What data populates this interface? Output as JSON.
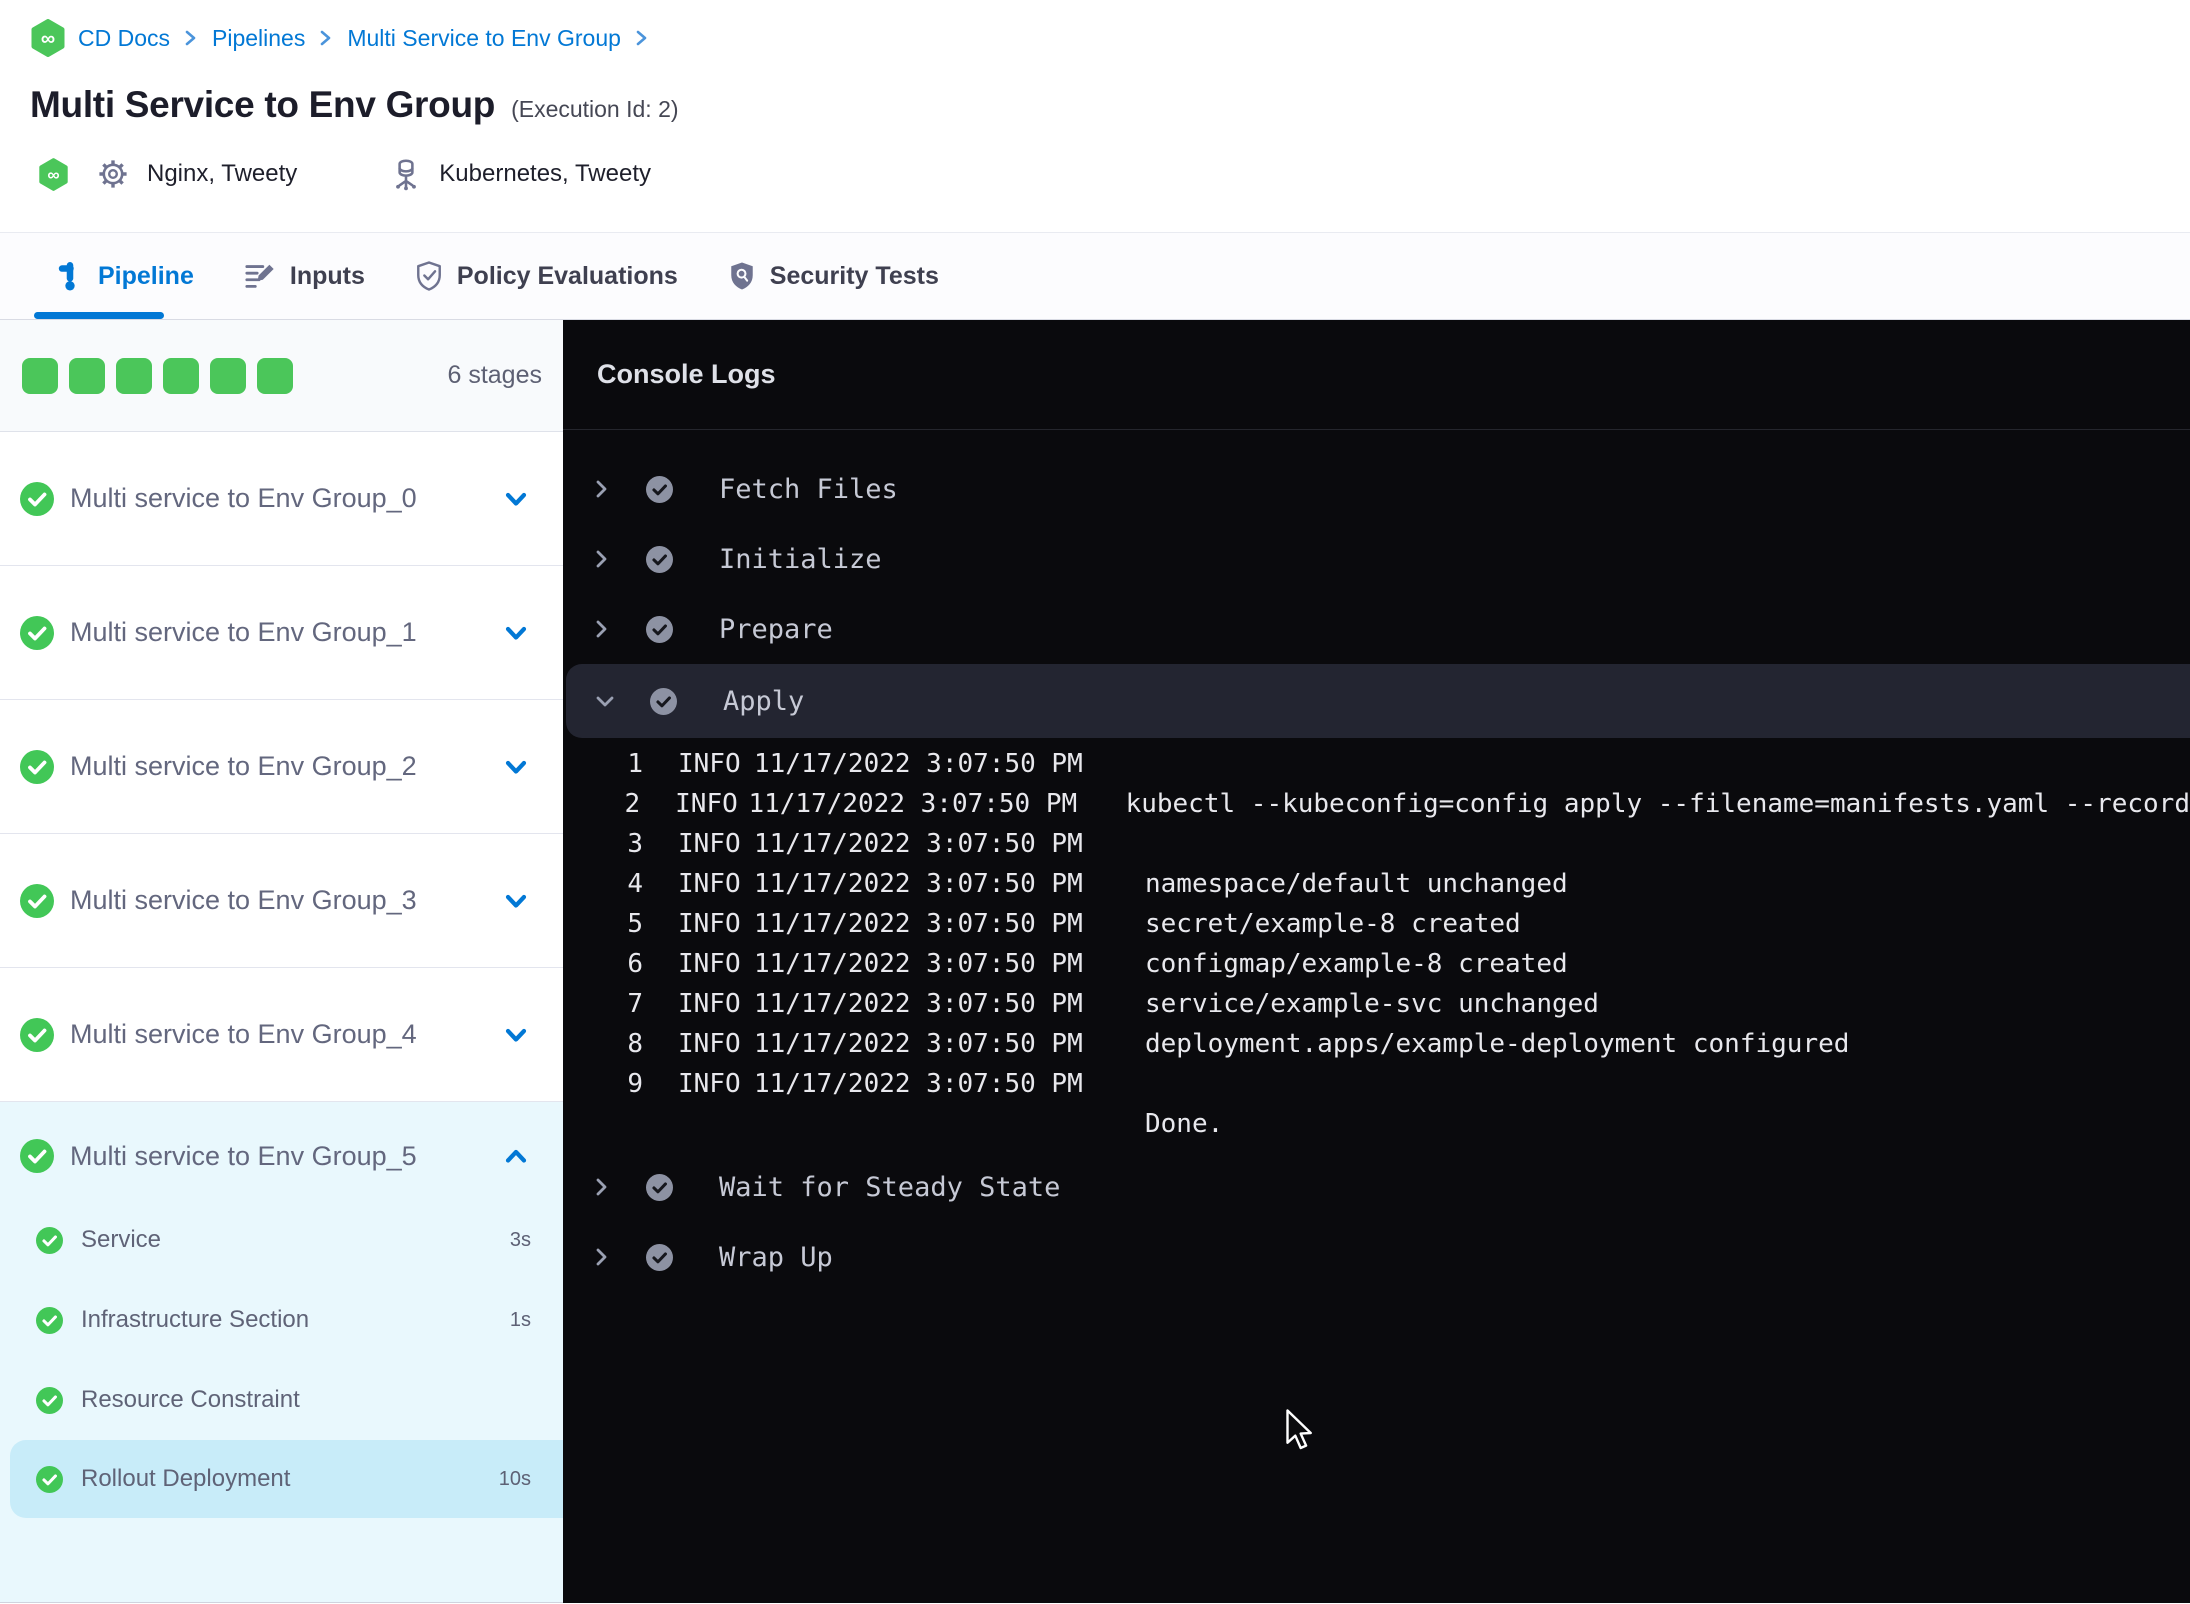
{
  "colors": {
    "accent_blue": "#0278d5",
    "success_green": "#42c757",
    "console_bg": "#0a0a0d",
    "console_row_highlight": "#232531",
    "selected_step_bg": "#c8ecf9",
    "expanded_stage_bg": "#e9f8fd"
  },
  "icons": {
    "harness_glyph": "∞"
  },
  "breadcrumb": {
    "crumbs": [
      "CD Docs",
      "Pipelines",
      "Multi Service to Env Group"
    ]
  },
  "header": {
    "title": "Multi Service to Env Group",
    "execution_label": "(Execution Id: 2)",
    "services_label": "Nginx, Tweety",
    "environments_label": "Kubernetes, Tweety"
  },
  "tabs": [
    {
      "label": "Pipeline"
    },
    {
      "label": "Inputs"
    },
    {
      "label": "Policy Evaluations"
    },
    {
      "label": "Security Tests"
    }
  ],
  "stage_panel": {
    "stage_count": "6 stages",
    "stages": [
      {
        "label": "Multi service to Env Group_0",
        "status": "success"
      },
      {
        "label": "Multi service to Env Group_1",
        "status": "success"
      },
      {
        "label": "Multi service to Env Group_2",
        "status": "success"
      },
      {
        "label": "Multi service to Env Group_3",
        "status": "success"
      },
      {
        "label": "Multi service to Env Group_4",
        "status": "success"
      },
      {
        "label": "Multi service to Env Group_5",
        "status": "success",
        "steps": [
          {
            "label": "Service",
            "duration": "3s"
          },
          {
            "label": "Infrastructure Section",
            "duration": "1s"
          },
          {
            "label": "Resource Constraint",
            "duration": ""
          },
          {
            "label": "Rollout Deployment",
            "duration": "10s"
          }
        ]
      }
    ]
  },
  "console": {
    "title": "Console Logs",
    "steps": [
      {
        "label": "Fetch Files"
      },
      {
        "label": "Initialize"
      },
      {
        "label": "Prepare"
      },
      {
        "label": "Apply"
      },
      {
        "label": "Wait for Steady State"
      },
      {
        "label": "Wrap Up"
      }
    ],
    "logs": [
      {
        "n": "1",
        "level": "INFO",
        "time": "11/17/2022 3:07:50 PM",
        "msg": ""
      },
      {
        "n": "2",
        "level": "INFO",
        "time": "11/17/2022 3:07:50 PM",
        "msg": "kubectl --kubeconfig=config apply --filename=manifests.yaml --record"
      },
      {
        "n": "3",
        "level": "INFO",
        "time": "11/17/2022 3:07:50 PM",
        "msg": ""
      },
      {
        "n": "4",
        "level": "INFO",
        "time": "11/17/2022 3:07:50 PM",
        "msg": "namespace/default unchanged"
      },
      {
        "n": "5",
        "level": "INFO",
        "time": "11/17/2022 3:07:50 PM",
        "msg": "secret/example-8 created"
      },
      {
        "n": "6",
        "level": "INFO",
        "time": "11/17/2022 3:07:50 PM",
        "msg": "configmap/example-8 created"
      },
      {
        "n": "7",
        "level": "INFO",
        "time": "11/17/2022 3:07:50 PM",
        "msg": "service/example-svc unchanged"
      },
      {
        "n": "8",
        "level": "INFO",
        "time": "11/17/2022 3:07:50 PM",
        "msg": "deployment.apps/example-deployment configured"
      },
      {
        "n": "9",
        "level": "INFO",
        "time": "11/17/2022 3:07:50 PM",
        "msg": ""
      },
      {
        "n": "",
        "level": "",
        "time": "",
        "msg": "Done."
      }
    ]
  }
}
